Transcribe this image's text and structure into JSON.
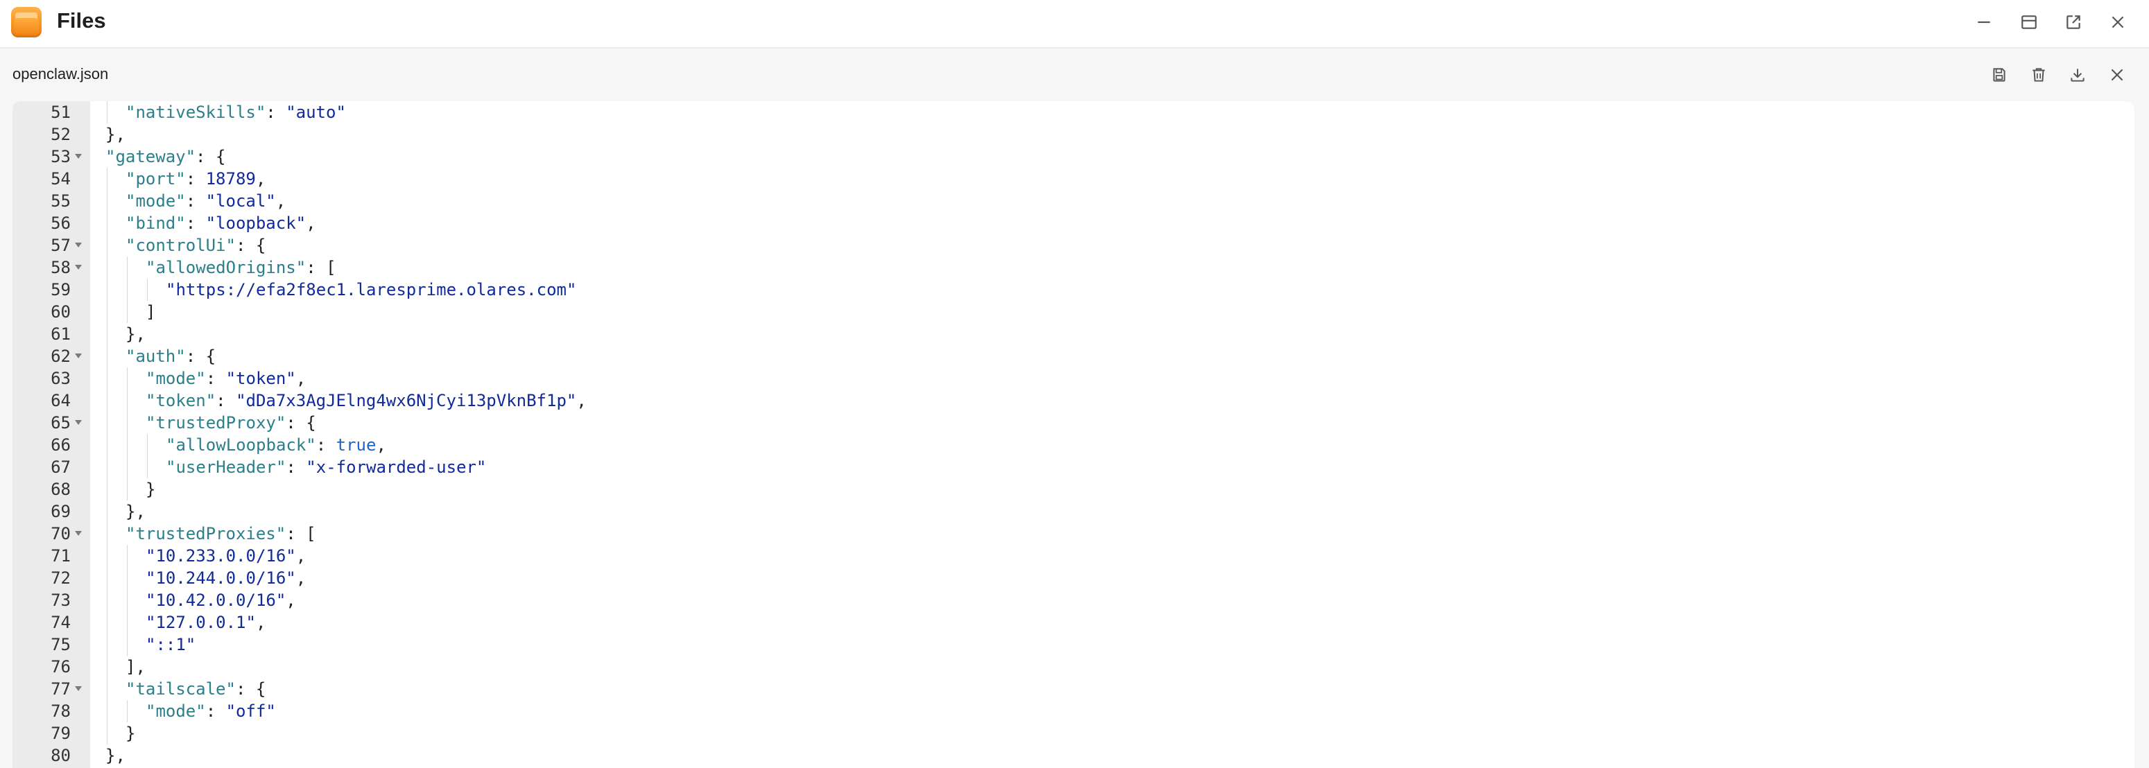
{
  "window": {
    "title": "Files",
    "icon": "files-folder-icon",
    "controls": [
      "minimize-icon",
      "maximize-icon",
      "open-external-icon",
      "close-icon"
    ]
  },
  "file": {
    "name": "openclaw.json",
    "actions": [
      "save-icon",
      "delete-icon",
      "download-icon",
      "close-icon"
    ]
  },
  "colors": {
    "key": "#2b7f8a",
    "string": "#102a9c",
    "boolean": "#1e66c2",
    "gutter": "#ebebeb"
  },
  "lines": [
    {
      "n": "51",
      "fold": false,
      "depth": 2,
      "tokens": [
        [
          "key",
          "\"nativeSkills\""
        ],
        [
          "p",
          ": "
        ],
        [
          "str",
          "\"auto\""
        ]
      ]
    },
    {
      "n": "52",
      "fold": false,
      "depth": 1,
      "tokens": [
        [
          "p",
          "},"
        ]
      ]
    },
    {
      "n": "53",
      "fold": true,
      "depth": 1,
      "tokens": [
        [
          "key",
          "\"gateway\""
        ],
        [
          "p",
          ": {"
        ]
      ]
    },
    {
      "n": "54",
      "fold": false,
      "depth": 2,
      "tokens": [
        [
          "key",
          "\"port\""
        ],
        [
          "p",
          ": "
        ],
        [
          "num",
          "18789"
        ],
        [
          "p",
          ","
        ]
      ]
    },
    {
      "n": "55",
      "fold": false,
      "depth": 2,
      "tokens": [
        [
          "key",
          "\"mode\""
        ],
        [
          "p",
          ": "
        ],
        [
          "str",
          "\"local\""
        ],
        [
          "p",
          ","
        ]
      ]
    },
    {
      "n": "56",
      "fold": false,
      "depth": 2,
      "tokens": [
        [
          "key",
          "\"bind\""
        ],
        [
          "p",
          ": "
        ],
        [
          "str",
          "\"loopback\""
        ],
        [
          "p",
          ","
        ]
      ]
    },
    {
      "n": "57",
      "fold": true,
      "depth": 2,
      "tokens": [
        [
          "key",
          "\"controlUi\""
        ],
        [
          "p",
          ": {"
        ]
      ]
    },
    {
      "n": "58",
      "fold": true,
      "depth": 3,
      "tokens": [
        [
          "key",
          "\"allowedOrigins\""
        ],
        [
          "p",
          ": ["
        ]
      ]
    },
    {
      "n": "59",
      "fold": false,
      "depth": 4,
      "tokens": [
        [
          "str",
          "\"https://efa2f8ec1.laresprime.olares.com\""
        ]
      ]
    },
    {
      "n": "60",
      "fold": false,
      "depth": 3,
      "tokens": [
        [
          "p",
          "]"
        ]
      ]
    },
    {
      "n": "61",
      "fold": false,
      "depth": 2,
      "tokens": [
        [
          "p",
          "},"
        ]
      ]
    },
    {
      "n": "62",
      "fold": true,
      "depth": 2,
      "tokens": [
        [
          "key",
          "\"auth\""
        ],
        [
          "p",
          ": {"
        ]
      ]
    },
    {
      "n": "63",
      "fold": false,
      "depth": 3,
      "tokens": [
        [
          "key",
          "\"mode\""
        ],
        [
          "p",
          ": "
        ],
        [
          "str",
          "\"token\""
        ],
        [
          "p",
          ","
        ]
      ]
    },
    {
      "n": "64",
      "fold": false,
      "depth": 3,
      "tokens": [
        [
          "key",
          "\"token\""
        ],
        [
          "p",
          ": "
        ],
        [
          "str",
          "\"dDa7x3AgJElng4wx6NjCyi13pVknBf1p\""
        ],
        [
          "p",
          ","
        ]
      ]
    },
    {
      "n": "65",
      "fold": true,
      "depth": 3,
      "tokens": [
        [
          "key",
          "\"trustedProxy\""
        ],
        [
          "p",
          ": {"
        ]
      ]
    },
    {
      "n": "66",
      "fold": false,
      "depth": 4,
      "tokens": [
        [
          "key",
          "\"allowLoopback\""
        ],
        [
          "p",
          ": "
        ],
        [
          "bool",
          "true"
        ],
        [
          "p",
          ","
        ]
      ]
    },
    {
      "n": "67",
      "fold": false,
      "depth": 4,
      "tokens": [
        [
          "key",
          "\"userHeader\""
        ],
        [
          "p",
          ": "
        ],
        [
          "str",
          "\"x-forwarded-user\""
        ]
      ]
    },
    {
      "n": "68",
      "fold": false,
      "depth": 3,
      "tokens": [
        [
          "p",
          "}"
        ]
      ]
    },
    {
      "n": "69",
      "fold": false,
      "depth": 2,
      "tokens": [
        [
          "p",
          "},"
        ]
      ]
    },
    {
      "n": "70",
      "fold": true,
      "depth": 2,
      "tokens": [
        [
          "key",
          "\"trustedProxies\""
        ],
        [
          "p",
          ": ["
        ]
      ]
    },
    {
      "n": "71",
      "fold": false,
      "depth": 3,
      "tokens": [
        [
          "str",
          "\"10.233.0.0/16\""
        ],
        [
          "p",
          ","
        ]
      ]
    },
    {
      "n": "72",
      "fold": false,
      "depth": 3,
      "tokens": [
        [
          "str",
          "\"10.244.0.0/16\""
        ],
        [
          "p",
          ","
        ]
      ]
    },
    {
      "n": "73",
      "fold": false,
      "depth": 3,
      "tokens": [
        [
          "str",
          "\"10.42.0.0/16\""
        ],
        [
          "p",
          ","
        ]
      ]
    },
    {
      "n": "74",
      "fold": false,
      "depth": 3,
      "tokens": [
        [
          "str",
          "\"127.0.0.1\""
        ],
        [
          "p",
          ","
        ]
      ]
    },
    {
      "n": "75",
      "fold": false,
      "depth": 3,
      "tokens": [
        [
          "str",
          "\"::1\""
        ]
      ]
    },
    {
      "n": "76",
      "fold": false,
      "depth": 2,
      "tokens": [
        [
          "p",
          "],"
        ]
      ]
    },
    {
      "n": "77",
      "fold": true,
      "depth": 2,
      "tokens": [
        [
          "key",
          "\"tailscale\""
        ],
        [
          "p",
          ": {"
        ]
      ]
    },
    {
      "n": "78",
      "fold": false,
      "depth": 3,
      "tokens": [
        [
          "key",
          "\"mode\""
        ],
        [
          "p",
          ": "
        ],
        [
          "str",
          "\"off\""
        ]
      ]
    },
    {
      "n": "79",
      "fold": false,
      "depth": 2,
      "tokens": [
        [
          "p",
          "}"
        ]
      ]
    },
    {
      "n": "80",
      "fold": false,
      "depth": 1,
      "tokens": [
        [
          "p",
          "},"
        ]
      ]
    }
  ]
}
